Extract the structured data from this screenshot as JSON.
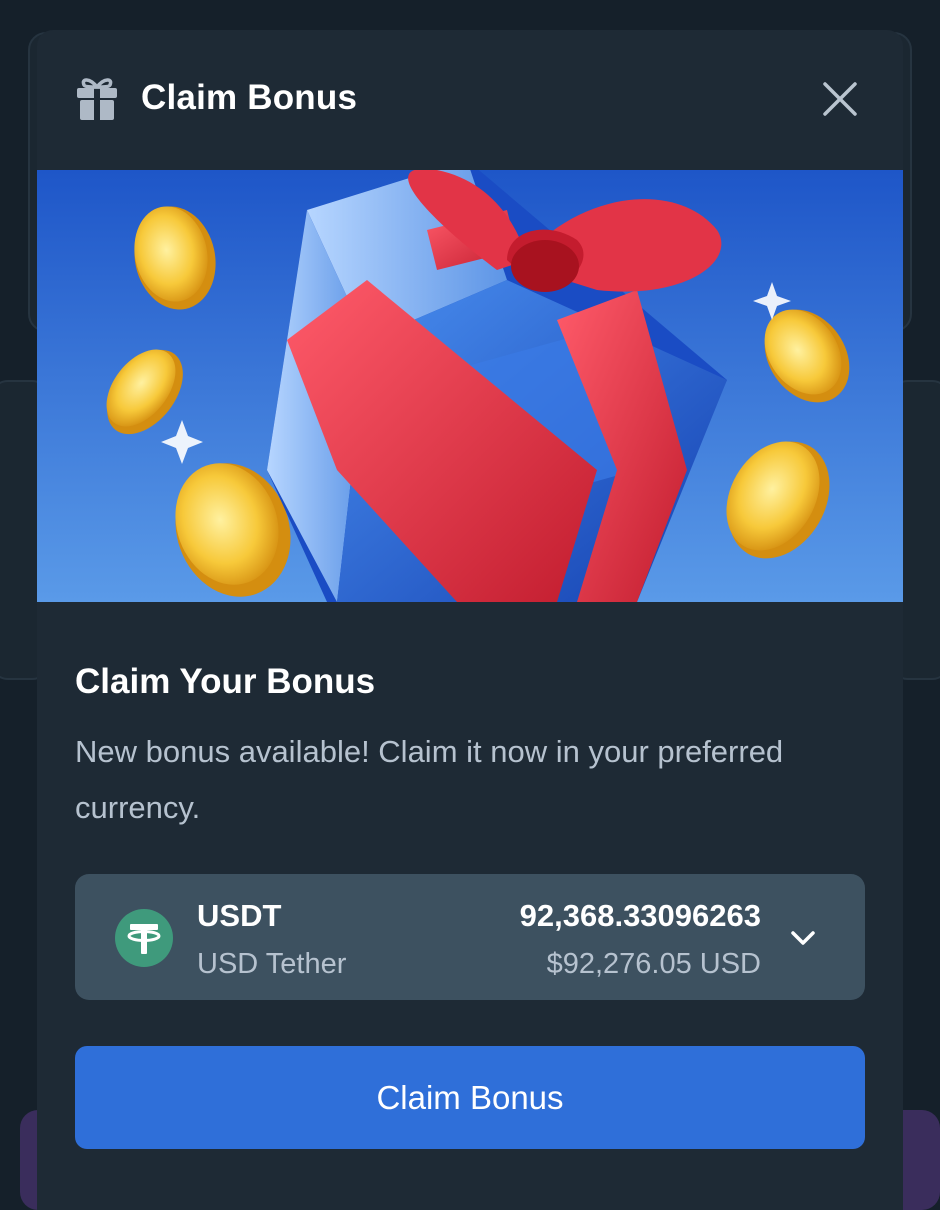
{
  "modal": {
    "title": "Claim Bonus",
    "header_icon": "gift-icon",
    "close_icon": "close-icon"
  },
  "banner": {
    "image": "gift-box-with-gold-coins"
  },
  "content": {
    "heading": "Claim Your Bonus",
    "description": "New bonus available! Claim it now in your preferred currency."
  },
  "currency": {
    "code": "USDT",
    "name": "USD Tether",
    "amount": "92,368.33096263",
    "usd_value": "$92,276.05 USD",
    "icon": "tether-icon",
    "dropdown_icon": "chevron-down-icon"
  },
  "action": {
    "claim_label": "Claim Bonus"
  },
  "colors": {
    "modal_bg": "#1e2a35",
    "select_bg": "#3d5160",
    "primary_button": "#2f6fd9",
    "tether_green": "#3f9a7c"
  }
}
